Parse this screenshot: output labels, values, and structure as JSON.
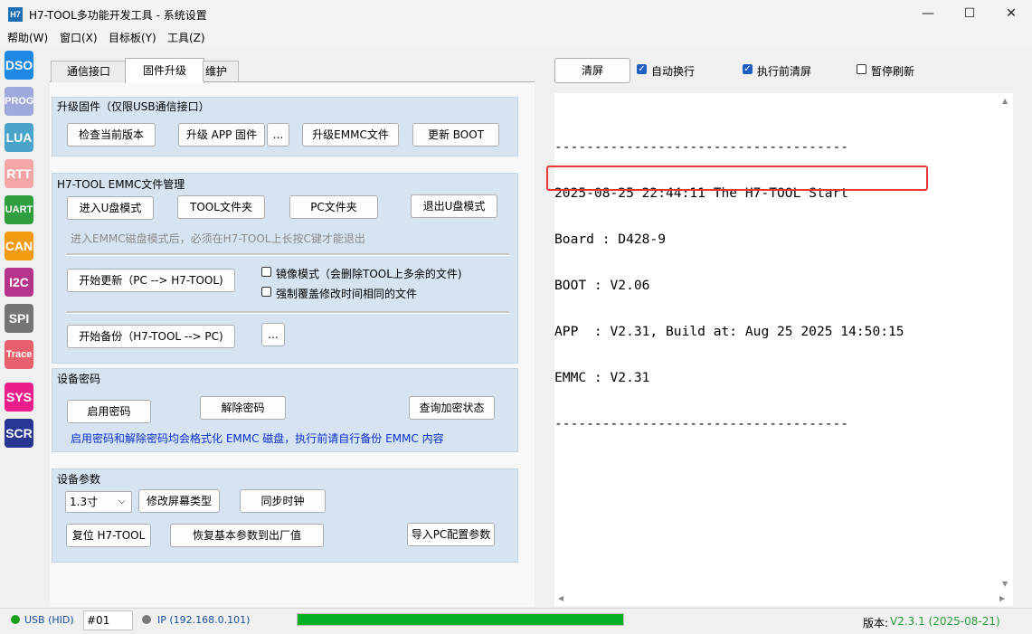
{
  "window": {
    "icon_text": "H7",
    "title": "H7-TOOL多功能开发工具 - 系统设置",
    "minimize_glyph": "—",
    "maximize_glyph": "☐",
    "close_glyph": "✕"
  },
  "menu": [
    "帮助(W)",
    "窗口(X)",
    "目标板(Y)",
    "工具(Z)"
  ],
  "sidebar": [
    {
      "label": "DSO",
      "color": "#1e88e5"
    },
    {
      "label": "PROG",
      "color": "#9fa8da"
    },
    {
      "label": "LUA",
      "color": "#4aa3c8"
    },
    {
      "label": "RTT",
      "color": "#f4a6a6"
    },
    {
      "label": "UART",
      "color": "#2e9e3f"
    },
    {
      "label": "CAN",
      "color": "#f39c12"
    },
    {
      "label": "I2C",
      "color": "#b5338a"
    },
    {
      "label": "SPI",
      "color": "#757575"
    },
    {
      "label": "Trace",
      "color": "#e8606b"
    },
    {
      "label": "SYS",
      "color": "#e91e8c"
    },
    {
      "label": "SCR",
      "color": "#283593"
    }
  ],
  "tabs": [
    "通信接口",
    "固件升级",
    "维护"
  ],
  "firmware": {
    "title": "升级固件（仅限USB通信接口）",
    "check_version": "检查当前版本",
    "upgrade_app": "升级 APP 固件",
    "more": "...",
    "upgrade_emmc": "升级EMMC文件",
    "update_boot": "更新 BOOT"
  },
  "emmc": {
    "title": "H7-TOOL EMMC文件管理",
    "enter_udisk": "进入U盘模式",
    "tool_folder": "TOOL文件夹",
    "pc_folder": "PC文件夹",
    "exit_udisk": "退出U盘模式",
    "hint": "进入EMMC磁盘模式后，必须在H7-TOOL上长按C键才能退出",
    "start_update": "开始更新（PC --> H7-TOOL)",
    "mirror_mode": "镜像模式（会删除TOOL上多余的文件)",
    "force_overwrite": "强制覆盖修改时间相同的文件",
    "start_backup": "开始备份（H7-TOOL --> PC)",
    "backup_more": "..."
  },
  "password": {
    "title": "设备密码",
    "enable": "启用密码",
    "remove": "解除密码",
    "query": "查询加密状态",
    "warning": "启用密码和解除密码均会格式化 EMMC 磁盘，执行前请自行备份 EMMC 内容"
  },
  "params": {
    "title": "设备参数",
    "screen_size": "1.3寸",
    "change_screen": "修改屏幕类型",
    "sync_clock": "同步时钟",
    "reset": "复位 H7-TOOL",
    "restore": "恢复基本参数到出厂值",
    "import_pc": "导入PC配置参数"
  },
  "console_toolbar": {
    "clear": "清屏",
    "auto_wrap": "自动换行",
    "auto_wrap_checked": true,
    "clear_before_exec": "执行前清屏",
    "clear_before_exec_checked": true,
    "pause_refresh": "暂停刷新",
    "pause_refresh_checked": false
  },
  "console_lines": [
    "-------------------------------------",
    "2025-08-25 22:44:11 The H7-TOOL Start",
    "Board : D428-9",
    "BOOT : V2.06",
    "APP  : V2.31, Build at: Aug 25 2025 14:50:15",
    "EMMC : V2.31",
    "-------------------------------------"
  ],
  "status": {
    "usb": "USB (HID)",
    "usb_color": "#1aa01a",
    "device_no": "#01",
    "ip": "IP (192.168.0.101)",
    "ip_color": "#7a7a7a",
    "progress": 1.0,
    "progress_color": "#06b025",
    "version_label": "版本:",
    "version_value": "V2.3.1 (2025-08-21)",
    "version_color": "#2e9e3f"
  }
}
